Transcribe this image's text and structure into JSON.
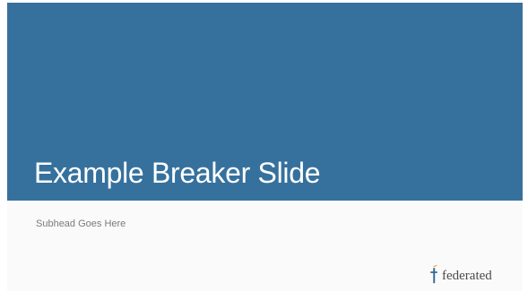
{
  "slide": {
    "title": "Example Breaker Slide",
    "subhead": "Subhead Goes Here"
  },
  "logo": {
    "text": "federated",
    "icon": "federated-logo-icon"
  },
  "colors": {
    "banner": "#36719d",
    "background": "#fafafa",
    "title_text": "#ffffff",
    "subhead_text": "#7a7a7a",
    "logo_text": "#4a4a4a",
    "logo_accent_orange": "#e8a33d",
    "logo_accent_blue": "#2f6796"
  }
}
